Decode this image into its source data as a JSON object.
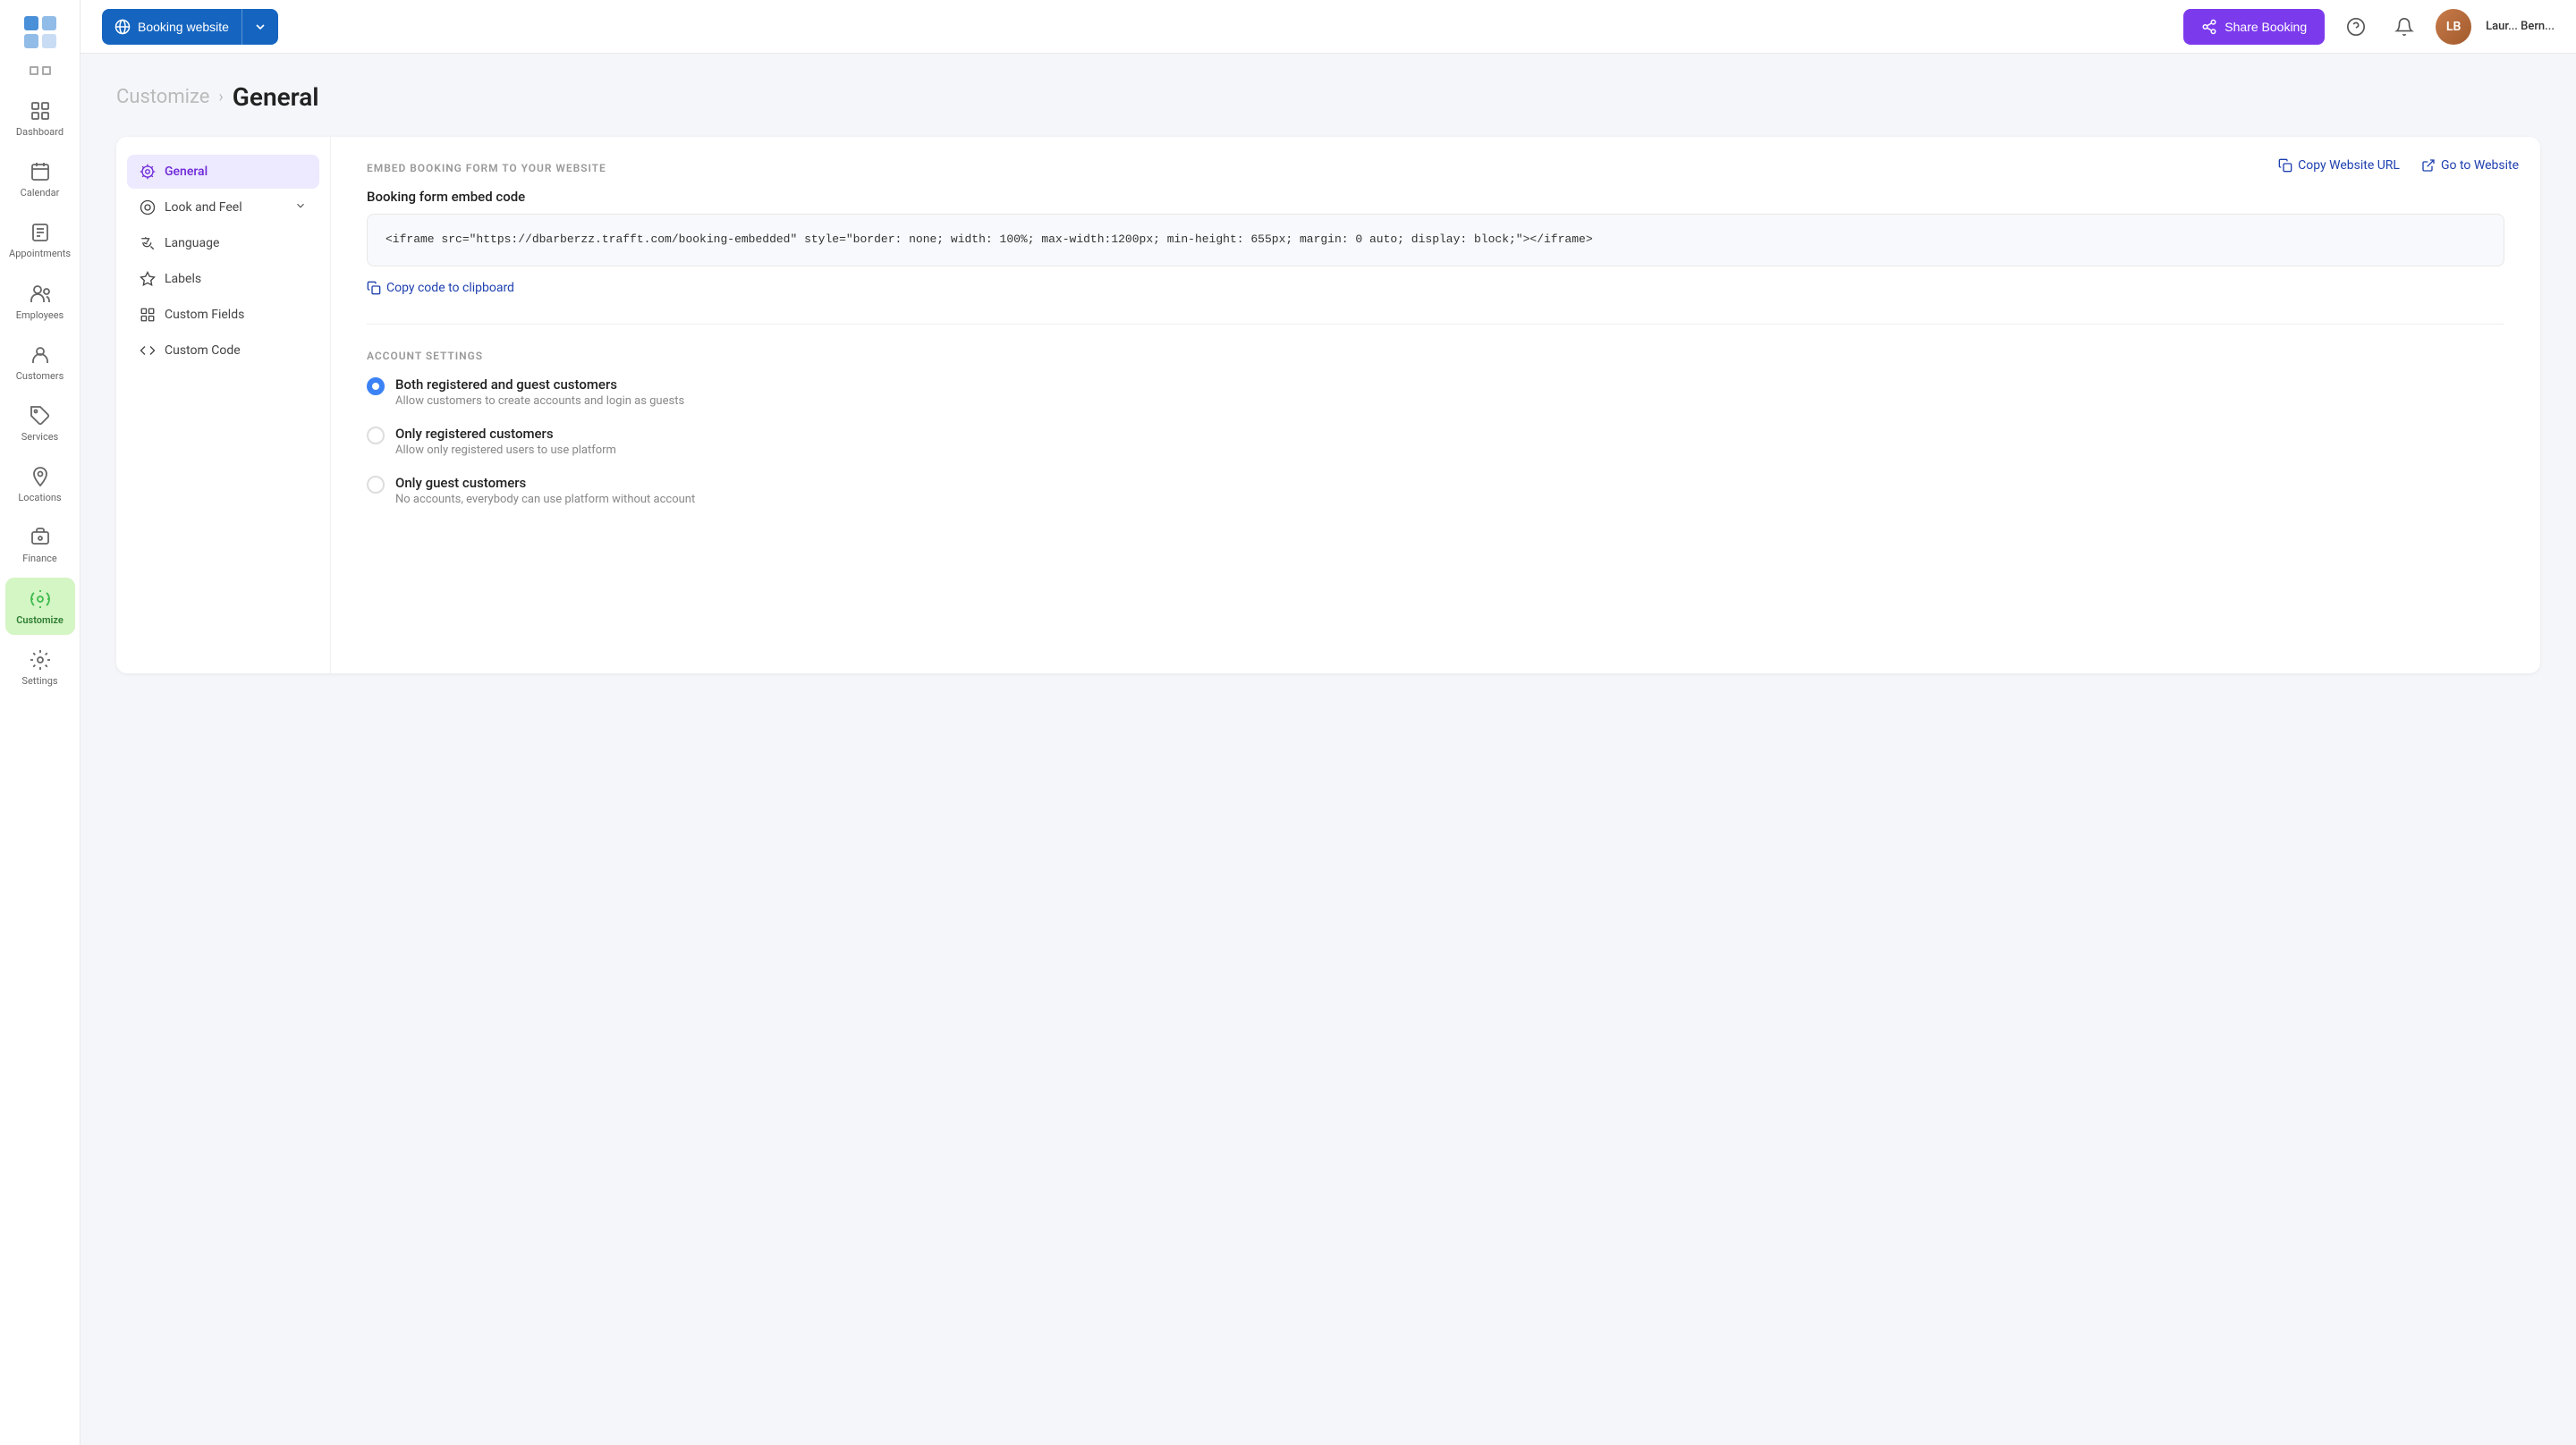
{
  "sidebar": {
    "items": [
      {
        "id": "dashboard",
        "label": "Dashboard",
        "icon": "grid"
      },
      {
        "id": "calendar",
        "label": "Calendar",
        "icon": "calendar"
      },
      {
        "id": "appointments",
        "label": "Appointments",
        "icon": "clipboard"
      },
      {
        "id": "employees",
        "label": "Employees",
        "icon": "users"
      },
      {
        "id": "customers",
        "label": "Customers",
        "icon": "person"
      },
      {
        "id": "services",
        "label": "Services",
        "icon": "tag"
      },
      {
        "id": "locations",
        "label": "Locations",
        "icon": "map-pin"
      },
      {
        "id": "finance",
        "label": "Finance",
        "icon": "camera"
      },
      {
        "id": "customize",
        "label": "Customize",
        "icon": "settings-gear",
        "active": true
      },
      {
        "id": "settings",
        "label": "Settings",
        "icon": "settings-cog"
      }
    ]
  },
  "topbar": {
    "booking_website_label": "Booking website",
    "share_booking_label": "Share Booking",
    "username": "Laur... Bern..."
  },
  "breadcrumb": {
    "parent": "Customize",
    "separator": "›",
    "current": "General"
  },
  "side_nav": {
    "items": [
      {
        "id": "general",
        "label": "General",
        "icon": "gear-star",
        "active": true
      },
      {
        "id": "look-and-feel",
        "label": "Look and Feel",
        "icon": "eye-circle",
        "has_expand": true
      },
      {
        "id": "language",
        "label": "Language",
        "icon": "translate"
      },
      {
        "id": "labels",
        "label": "Labels",
        "icon": "diamond"
      },
      {
        "id": "custom-fields",
        "label": "Custom Fields",
        "icon": "grid-small"
      },
      {
        "id": "custom-code",
        "label": "Custom Code",
        "icon": "code-brackets"
      }
    ]
  },
  "panel": {
    "copy_url_label": "Copy Website URL",
    "go_to_website_label": "Go to Website",
    "embed_section_label": "EMBED BOOKING FORM TO YOUR WEBSITE",
    "booking_form_label": "Booking form embed code",
    "embed_code": "<iframe src=\"https://dbarberzz.trafft.com/booking-embedded\"\nstyle=\"border: none; width: 100%; max-width:1200px; min-height:\n655px; margin: 0 auto; display: block;\"></iframe>",
    "copy_code_label": "Copy code to clipboard",
    "account_section_label": "ACCOUNT SETTINGS",
    "radio_options": [
      {
        "id": "both",
        "label": "Both registered and guest customers",
        "description": "Allow customers to create accounts and login as guests",
        "checked": true
      },
      {
        "id": "registered",
        "label": "Only registered customers",
        "description": "Allow only registered users to use platform",
        "checked": false
      },
      {
        "id": "guest",
        "label": "Only guest customers",
        "description": "No accounts, everybody can use platform without account",
        "checked": false
      }
    ]
  },
  "colors": {
    "primary_blue": "#1565c0",
    "purple": "#7c3aed",
    "active_green": "#d4f5c4",
    "link_blue": "#1e40af"
  }
}
